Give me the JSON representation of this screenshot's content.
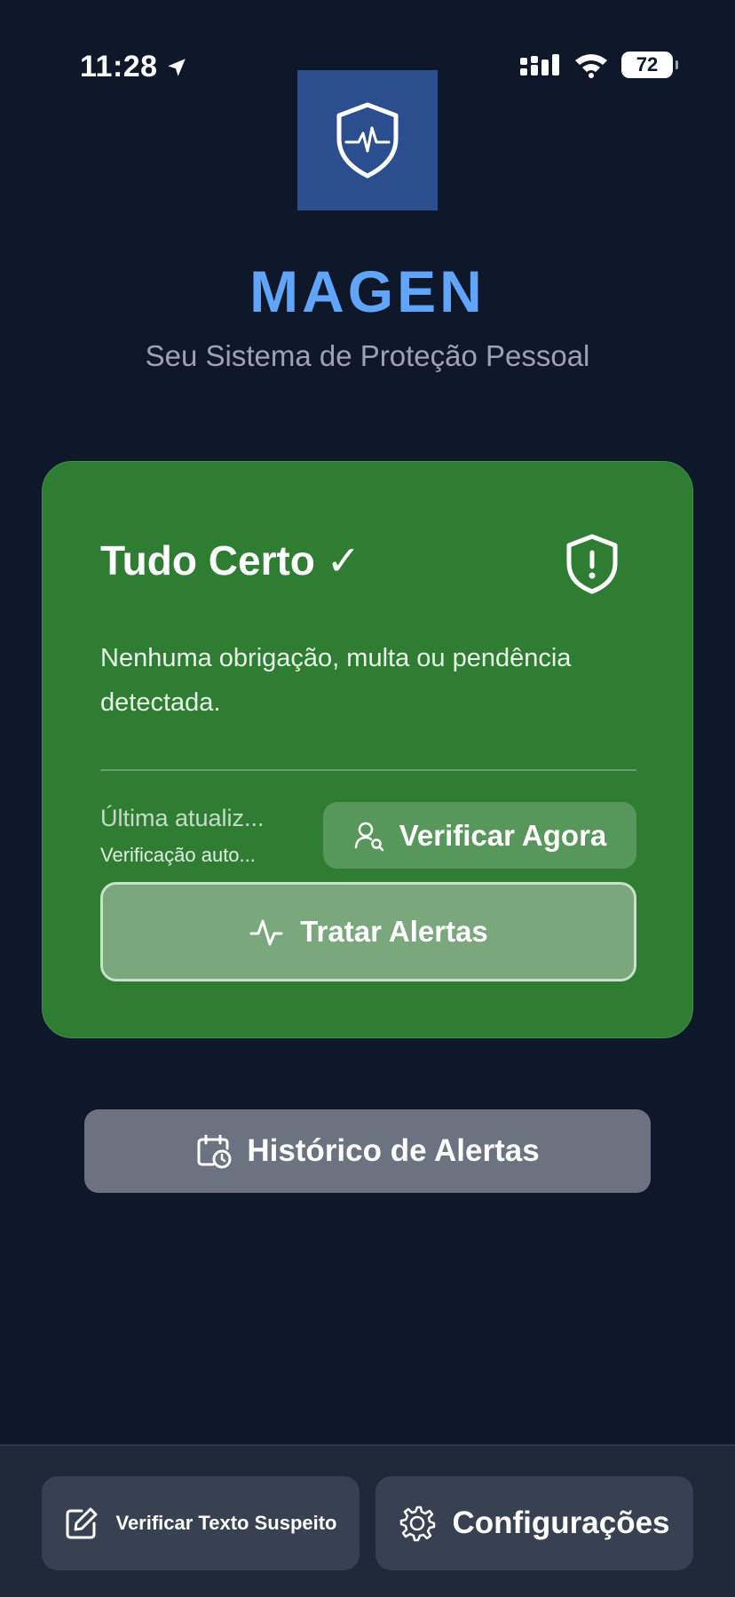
{
  "status_bar": {
    "time": "11:28",
    "battery": "72"
  },
  "header": {
    "logo_icon": "shield-heartbeat-icon",
    "title": "MAGEN",
    "subtitle": "Seu Sistema de Proteção Pessoal"
  },
  "status_card": {
    "title": "Tudo Certo ✓",
    "message": "Nenhuma obrigação, multa ou pendência detectada.",
    "last_update": "Última atualiz...",
    "auto_check": "Verificação auto...",
    "verify_button": "Verificar Agora",
    "alerts_button": "Tratar Alertas",
    "color": "#2e7d32"
  },
  "history_button": "Histórico de Alertas",
  "bottom_bar": {
    "suspect_text_button": "Verificar Texto Suspeito",
    "settings_button": "Configurações"
  },
  "colors": {
    "background": "#0f172a",
    "accent": "#60a5fa",
    "card": "#2e7d32"
  }
}
